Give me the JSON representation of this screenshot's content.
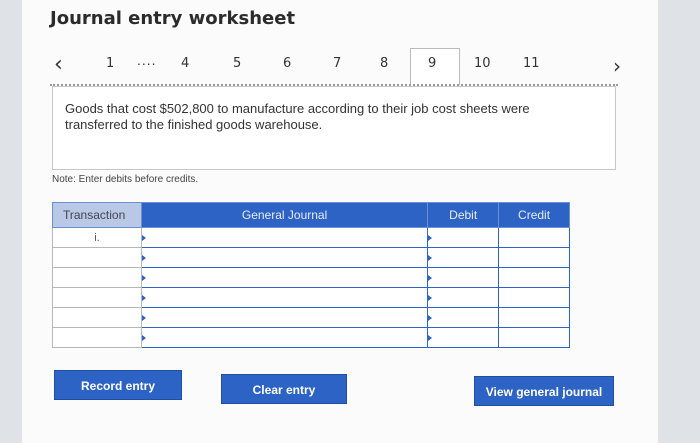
{
  "title": "Journal entry worksheet",
  "nav": {
    "prev_icon": "chevron-left-icon",
    "next_icon": "chevron-right-icon",
    "steps": [
      "1",
      "4",
      "5",
      "6",
      "7",
      "8",
      "9",
      "10",
      "11"
    ],
    "ellipsis": "....",
    "active_step": "9"
  },
  "prompt": "Goods that cost $502,800 to manufacture according to their job cost sheets were transferred to the finished goods warehouse.",
  "note": "Note: Enter debits before credits.",
  "table": {
    "headers": {
      "transaction": "Transaction",
      "general_journal": "General Journal",
      "debit": "Debit",
      "credit": "Credit"
    },
    "rows": [
      {
        "transaction": "i.",
        "account": "",
        "debit": "",
        "credit": ""
      },
      {
        "transaction": "",
        "account": "",
        "debit": "",
        "credit": ""
      },
      {
        "transaction": "",
        "account": "",
        "debit": "",
        "credit": ""
      },
      {
        "transaction": "",
        "account": "",
        "debit": "",
        "credit": ""
      },
      {
        "transaction": "",
        "account": "",
        "debit": "",
        "credit": ""
      },
      {
        "transaction": "",
        "account": "",
        "debit": "",
        "credit": ""
      }
    ]
  },
  "buttons": {
    "record": "Record entry",
    "clear": "Clear entry",
    "view": "View general journal"
  },
  "colors": {
    "accent": "#2c63c5",
    "background": "#dfe3e8"
  }
}
